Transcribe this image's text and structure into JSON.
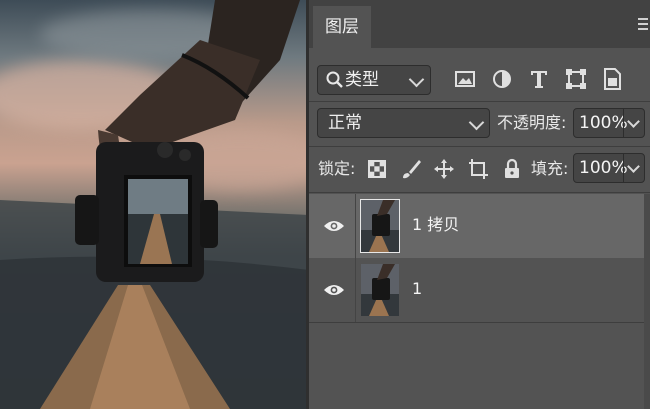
{
  "panel": {
    "tab_label": "图层",
    "filter": {
      "label": "类型"
    },
    "filter_icons": [
      "image-filter-icon",
      "adjustment-filter-icon",
      "type-filter-icon",
      "shape-filter-icon",
      "smart-object-filter-icon"
    ],
    "blend_mode": "正常",
    "opacity": {
      "label": "不透明度:",
      "value": "100%"
    },
    "lock": {
      "label": "锁定:",
      "icons": [
        "lock-transparent-pixels-icon",
        "lock-image-pixels-icon",
        "lock-position-icon",
        "lock-artboard-icon",
        "lock-all-icon"
      ]
    },
    "fill": {
      "label": "填充:",
      "value": "100%"
    },
    "layers": [
      {
        "name": "1 拷贝",
        "selected": true
      },
      {
        "name": "1",
        "selected": false
      }
    ]
  },
  "colors": {
    "panel_bg": "#535353",
    "tab_bar_bg": "#424242",
    "selected_layer_bg": "#676767"
  }
}
